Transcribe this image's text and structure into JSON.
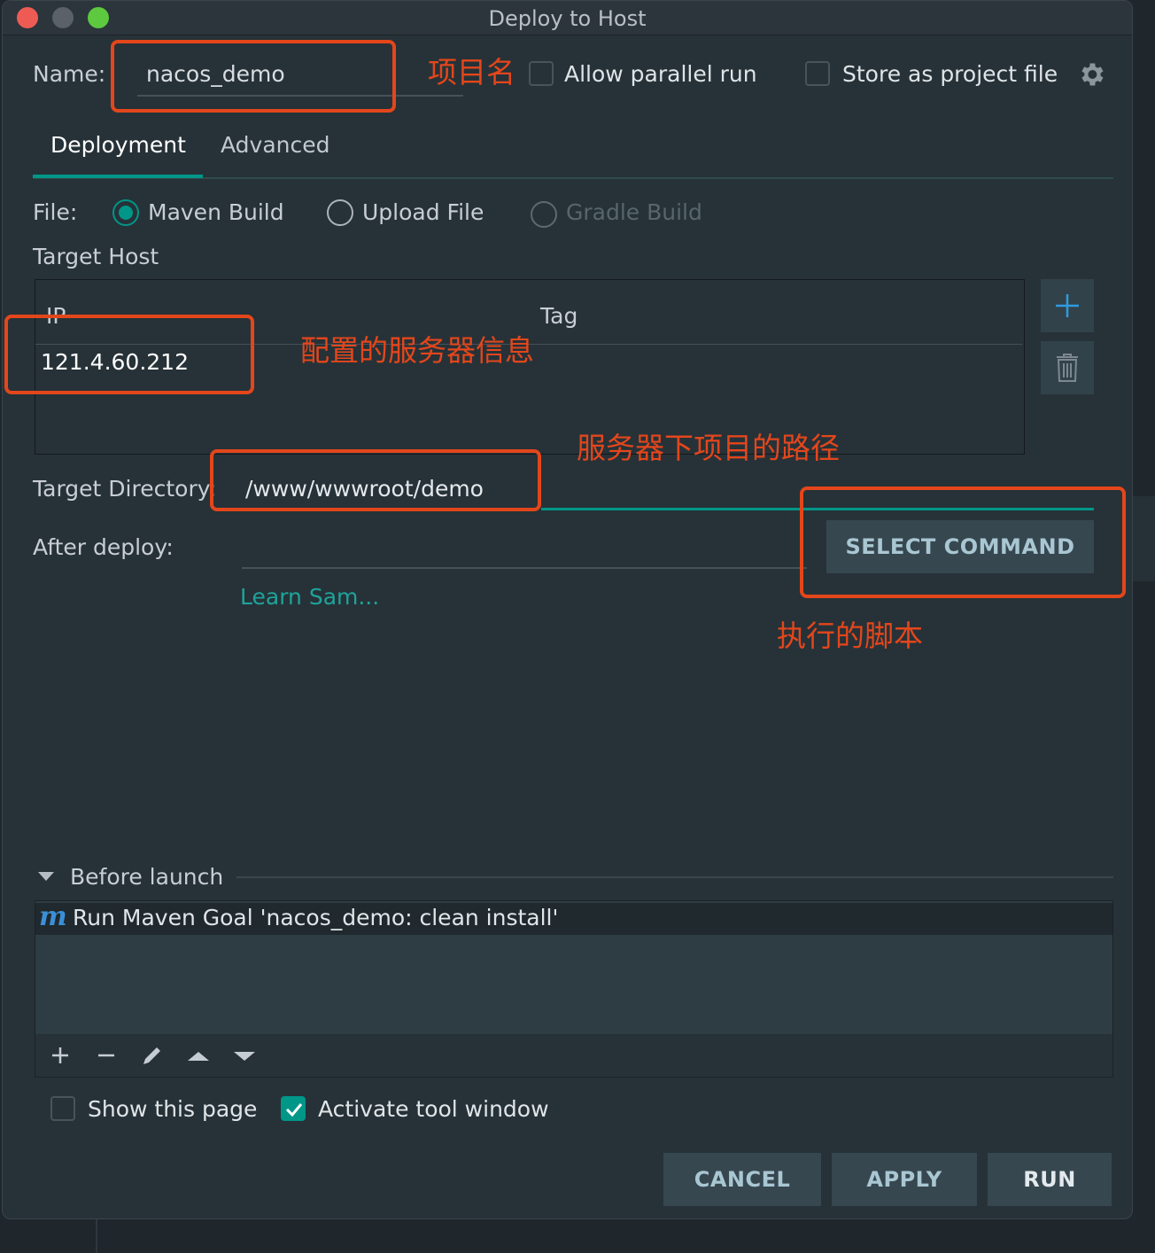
{
  "window": {
    "title": "Deploy to Host"
  },
  "name_row": {
    "label": "Name:",
    "value": "nacos_demo",
    "allow_parallel_label": "Allow parallel run",
    "allow_parallel_checked": false,
    "store_label": "Store as project file",
    "store_checked": false
  },
  "tabs": [
    {
      "label": "Deployment",
      "active": true
    },
    {
      "label": "Advanced",
      "active": false
    }
  ],
  "file": {
    "label": "File:",
    "options": [
      {
        "label": "Maven Build",
        "selected": true,
        "enabled": true
      },
      {
        "label": "Upload File",
        "selected": false,
        "enabled": true
      },
      {
        "label": "Gradle Build",
        "selected": false,
        "enabled": false
      }
    ]
  },
  "target_host": {
    "label": "Target Host",
    "columns": [
      "IP",
      "Tag"
    ],
    "rows": [
      {
        "ip": "121.4.60.212",
        "tag": ""
      }
    ]
  },
  "target_directory": {
    "label": "Target Directory:",
    "value": "/www/wwwroot/demo"
  },
  "after_deploy": {
    "label": "After deploy:",
    "button": "SELECT COMMAND",
    "link": "Learn Sam..."
  },
  "annotations": {
    "project_name": "项目名",
    "server_info": "配置的服务器信息",
    "server_path": "服务器下项目的路径",
    "script": "执行的脚本"
  },
  "before_launch": {
    "title": "Before launch",
    "items": [
      {
        "icon": "maven-icon",
        "label": "Run Maven Goal 'nacos_demo: clean install'"
      }
    ]
  },
  "options": {
    "show_page_label": "Show this page",
    "show_page_checked": false,
    "activate_label": "Activate tool window",
    "activate_checked": true
  },
  "buttons": {
    "cancel": "CANCEL",
    "apply": "APPLY",
    "run": "RUN"
  },
  "colors": {
    "accent": "#009688",
    "annotation": "#e4461b",
    "background": "#263238"
  }
}
